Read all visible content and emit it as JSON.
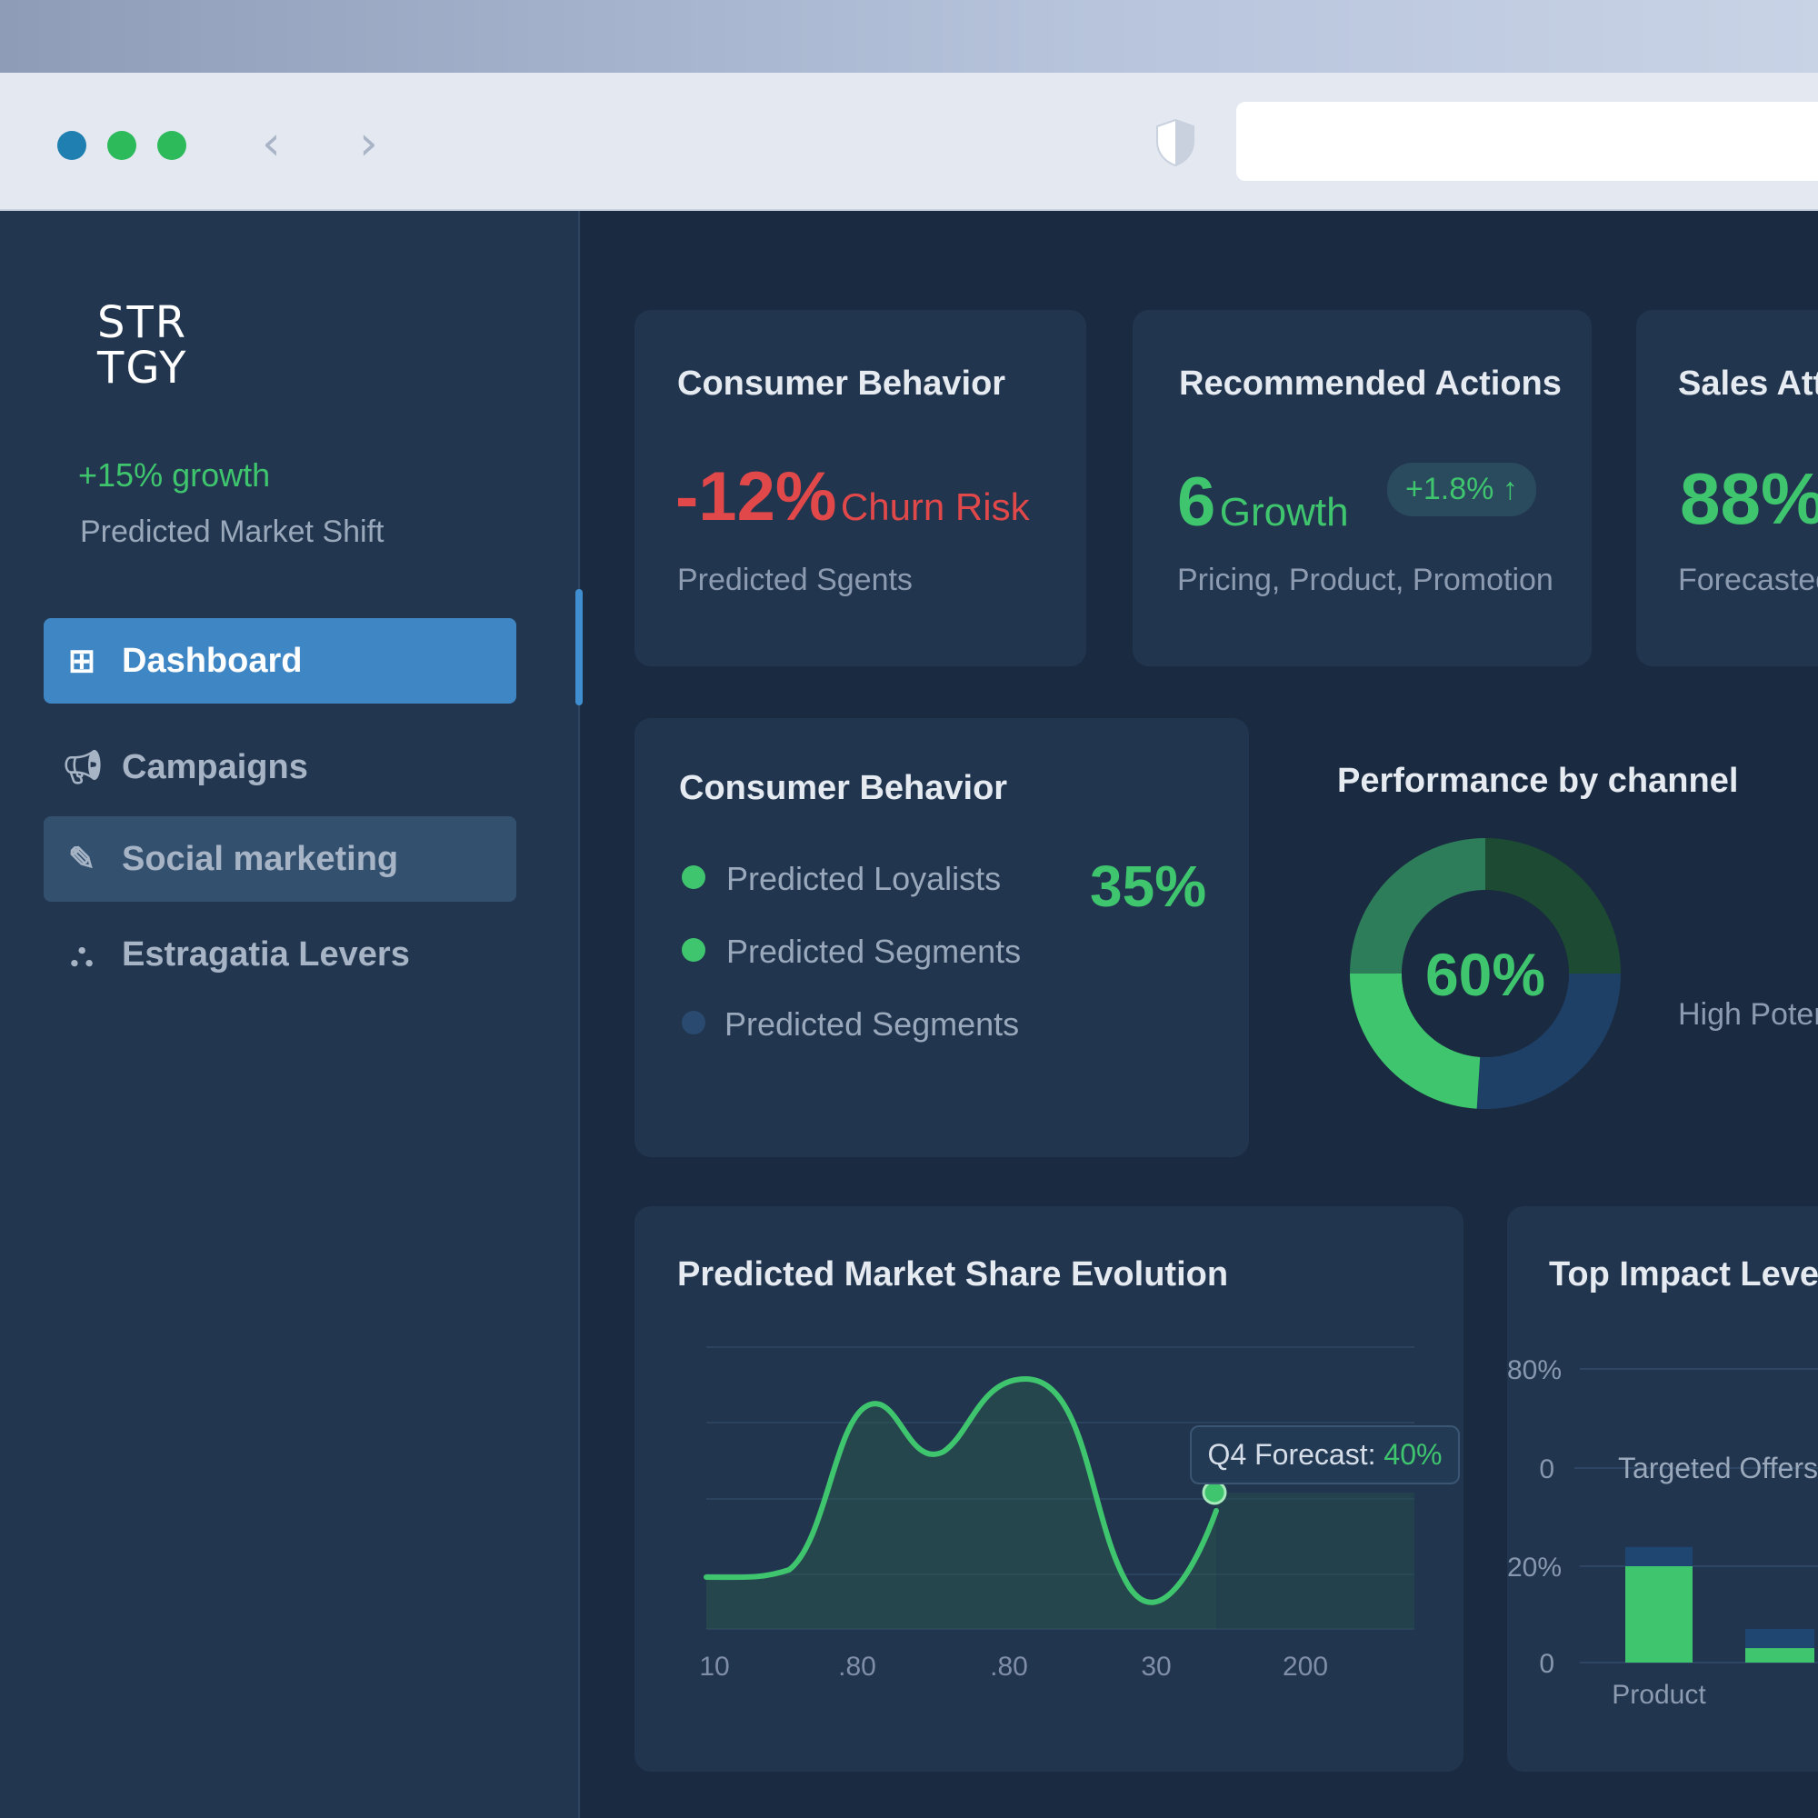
{
  "browser": {
    "back": "‹",
    "forward": "›",
    "shield_icon": "shield-icon",
    "dot_colors": [
      "#1e7fb0",
      "#2dba5a",
      "#2dba5a"
    ]
  },
  "sidebar": {
    "logo_line1": "STR",
    "logo_line2": "TGY",
    "growth": "+15% growth",
    "growth_caption": "Predicted Market Shift",
    "items": [
      {
        "label": "Dashboard",
        "icon": "grid-icon",
        "active": true
      },
      {
        "label": "Campaigns",
        "icon": "megaphone-icon"
      },
      {
        "label": "Social marketing",
        "icon": "edit-icon",
        "highlight": true
      },
      {
        "label": "Estragatia Levers",
        "icon": "hierarchy-icon"
      }
    ]
  },
  "cards": {
    "consumer": {
      "title": "Consumer Behavior",
      "value": "-12%",
      "value_label": "Churn Risk",
      "caption": "Predicted Sgents"
    },
    "actions": {
      "title": "Recommended Actions",
      "value": "6",
      "value_label": "Growth",
      "badge": "+1.8% ↑",
      "caption": "Pricing, Product, Promotion"
    },
    "sales": {
      "title": "Sales Att",
      "value": "88%",
      "caption": "Forecasted"
    }
  },
  "segments": {
    "title": "Consumer Behavior",
    "items": [
      {
        "label": "Predicted Loyalists",
        "color": "#3fc56e"
      },
      {
        "label": "Predicted Segments",
        "color": "#3fc56e"
      },
      {
        "label": "Predicted Segments",
        "color": "#2b4a70"
      }
    ],
    "value": "35%"
  },
  "performance": {
    "title": "Performance by channel",
    "center": "60%",
    "side_label": "High Poter"
  },
  "chart_data": [
    {
      "type": "line",
      "title": "Predicted Market Share Evolution",
      "x_ticks": [
        "10",
        ".80",
        ".80",
        "30",
        "200"
      ],
      "annotation": "Q4 Forecast:",
      "annotation_value": "40%",
      "color": "#3fc56e"
    },
    {
      "type": "pie",
      "title": "Performance by channel",
      "center_label": "60%",
      "slices": [
        {
          "value": 25,
          "color": "#1d4a33"
        },
        {
          "value": 26,
          "color": "#1f4066"
        },
        {
          "value": 24,
          "color": "#3fc56e"
        },
        {
          "value": 25,
          "color": "#2e7d5a"
        }
      ]
    },
    {
      "type": "bar",
      "title": "Top Impact Lever",
      "y_ticks": [
        "80%",
        "0",
        "20%",
        "0"
      ],
      "annotation": "Targeted Offers",
      "categories": [
        "Product",
        ""
      ],
      "series": [
        {
          "color": "#3fc56e",
          "values": [
            20,
            3
          ]
        },
        {
          "color": "#1f4670",
          "values": [
            4,
            4
          ]
        }
      ]
    }
  ]
}
